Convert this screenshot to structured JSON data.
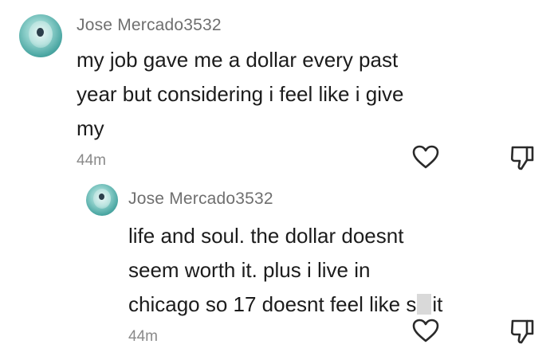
{
  "comments": [
    {
      "username": "Jose Mercado3532",
      "lines": [
        "my job gave me a dollar every past",
        "year but considering i feel like i give",
        "my"
      ],
      "time": "44m",
      "like_icon": "heart-outline-icon",
      "dislike_icon": "thumbs-down-icon"
    },
    {
      "username": "Jose Mercado3532",
      "lines": [
        "life and soul. the dollar doesnt",
        "seem worth it. plus i live in"
      ],
      "last_line_before": "chicago so 17 doesnt feel like s",
      "last_line_after": "it",
      "time": "44m",
      "like_icon": "heart-outline-icon",
      "dislike_icon": "thumbs-down-icon"
    }
  ],
  "colors": {
    "username": "#6f6f6f",
    "text": "#1c1c1c",
    "time": "#8a8a8a",
    "icon": "#2a2a2a"
  }
}
